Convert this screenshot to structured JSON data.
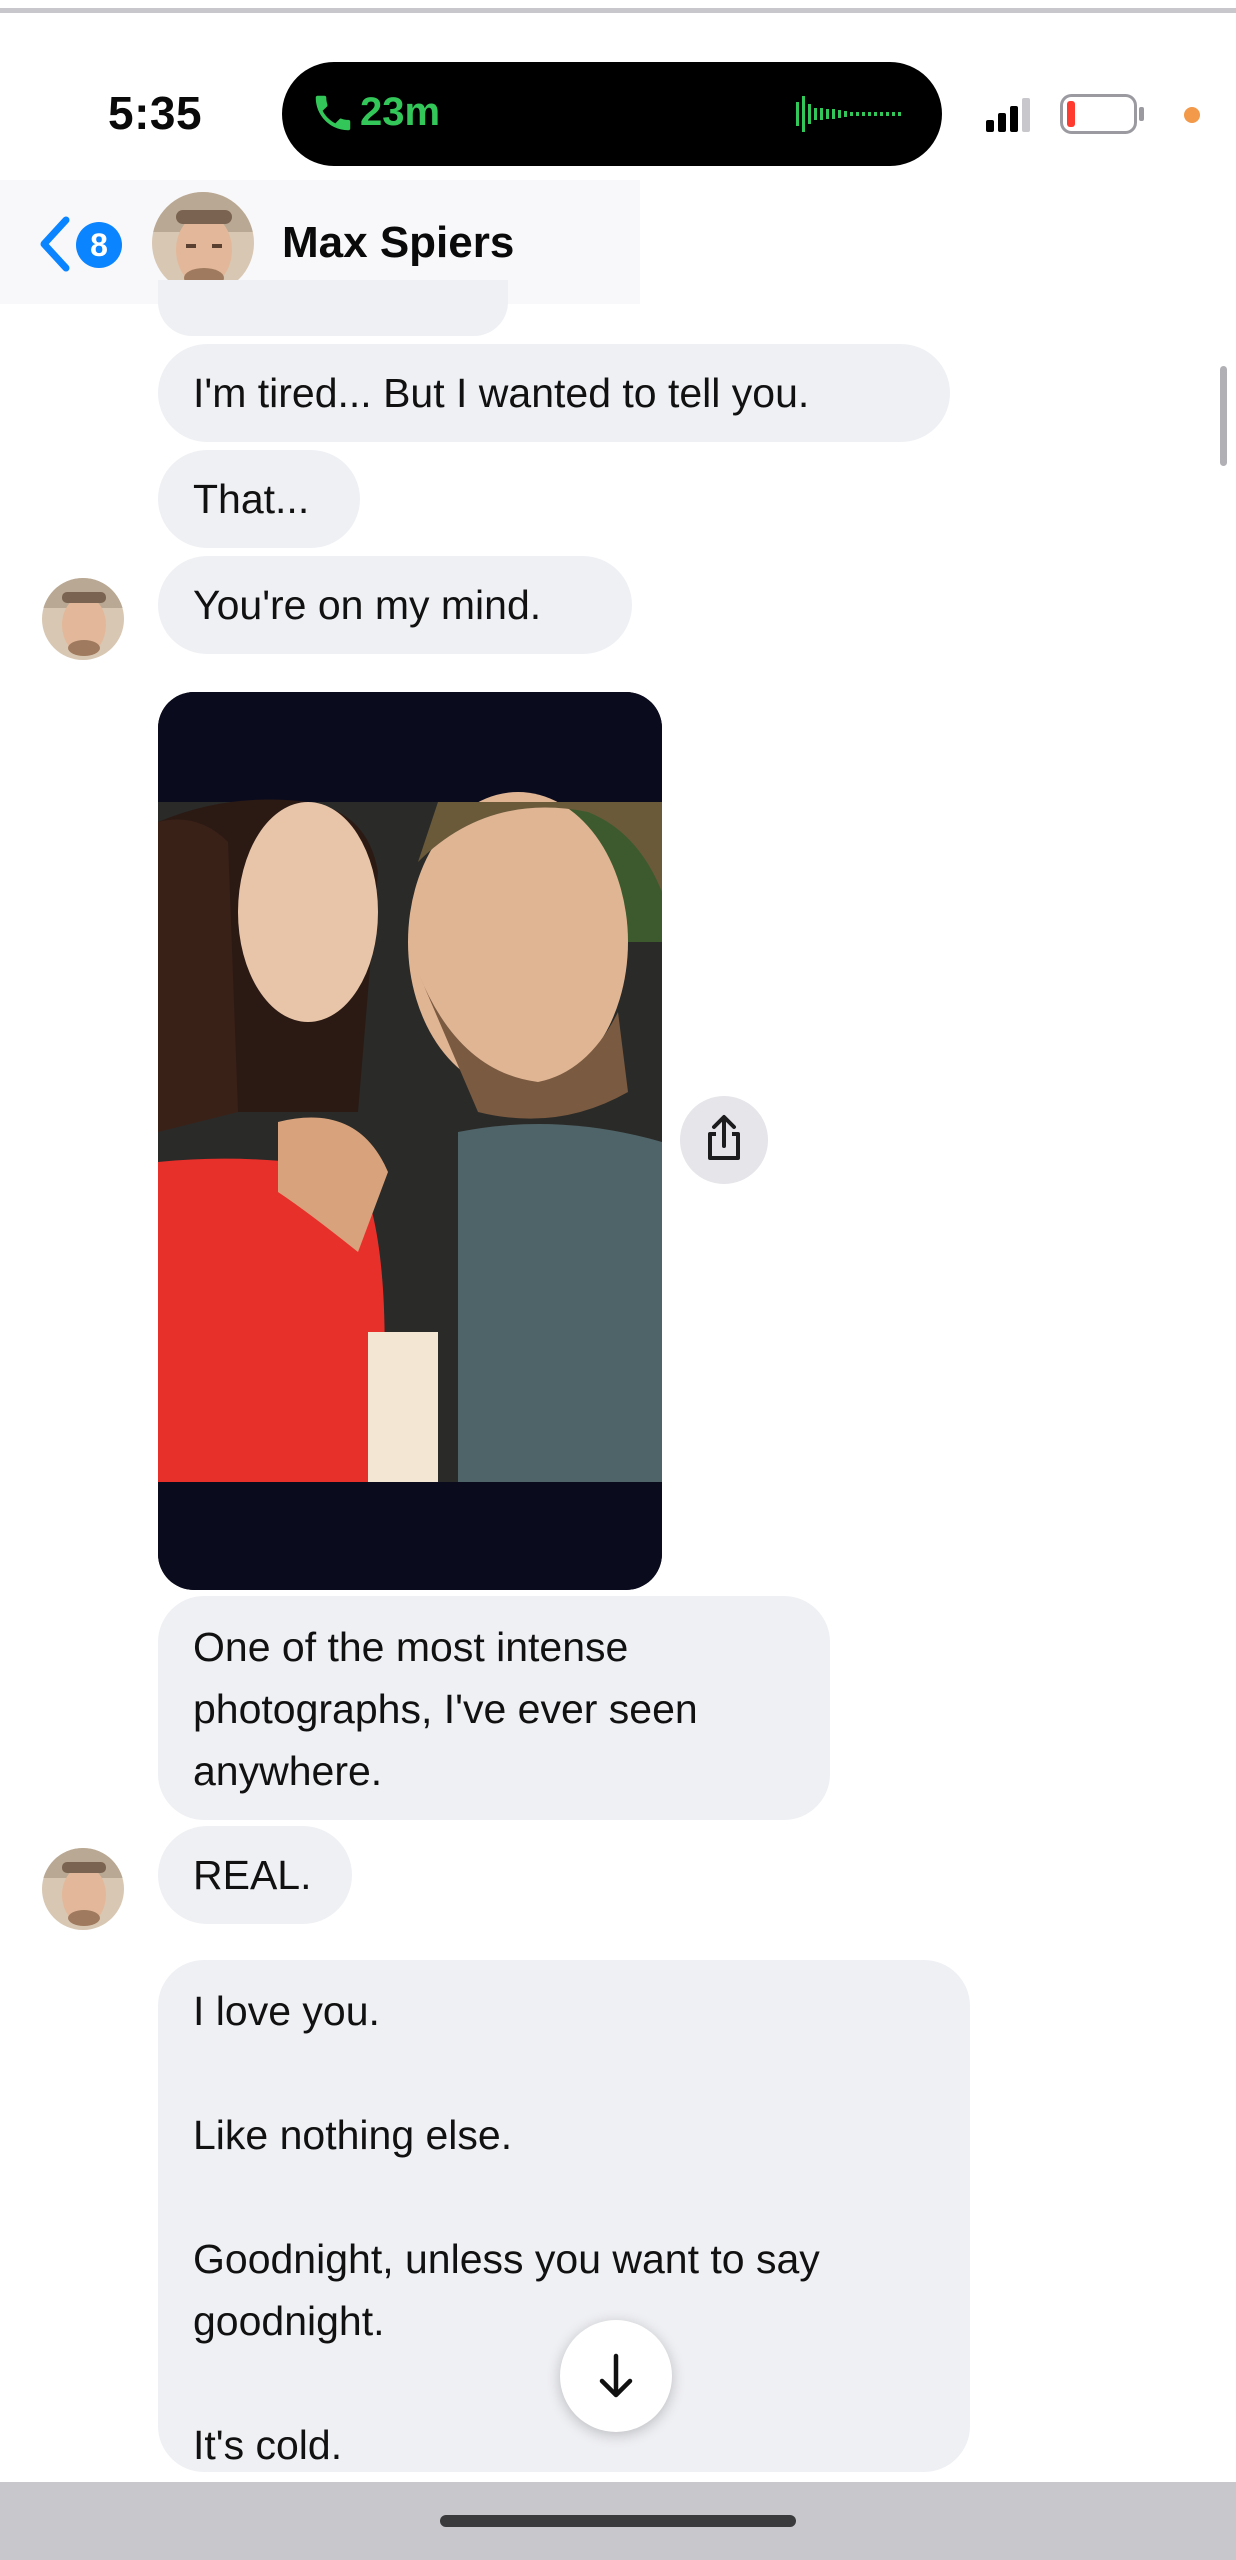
{
  "status_bar": {
    "time": "5:35",
    "call_duration": "23m",
    "call_color": "#33c759",
    "icons": [
      "phone-icon",
      "waveform-icon",
      "signal-icon",
      "battery-icon"
    ]
  },
  "header": {
    "back_badge_count": "8",
    "contact_name": "Max Spiers",
    "accent": "#0a84ff"
  },
  "messages": [
    {
      "text": "I'm tired... But I wanted to tell you."
    },
    {
      "text": "That..."
    },
    {
      "text": "You're on my mind."
    },
    {
      "type": "image",
      "description_icon": "photo"
    },
    {
      "text": "One of the most intense\nphotographs, I've ever seen\nanywhere."
    },
    {
      "text": "REAL."
    },
    {
      "text": "I love you.\n\nLike nothing else.\n\nGoodnight, unless you want to say\ngoodnight.\n\nIt's cold."
    }
  ],
  "colors": {
    "bubble": "#eff0f4",
    "background": "#ffffff"
  }
}
